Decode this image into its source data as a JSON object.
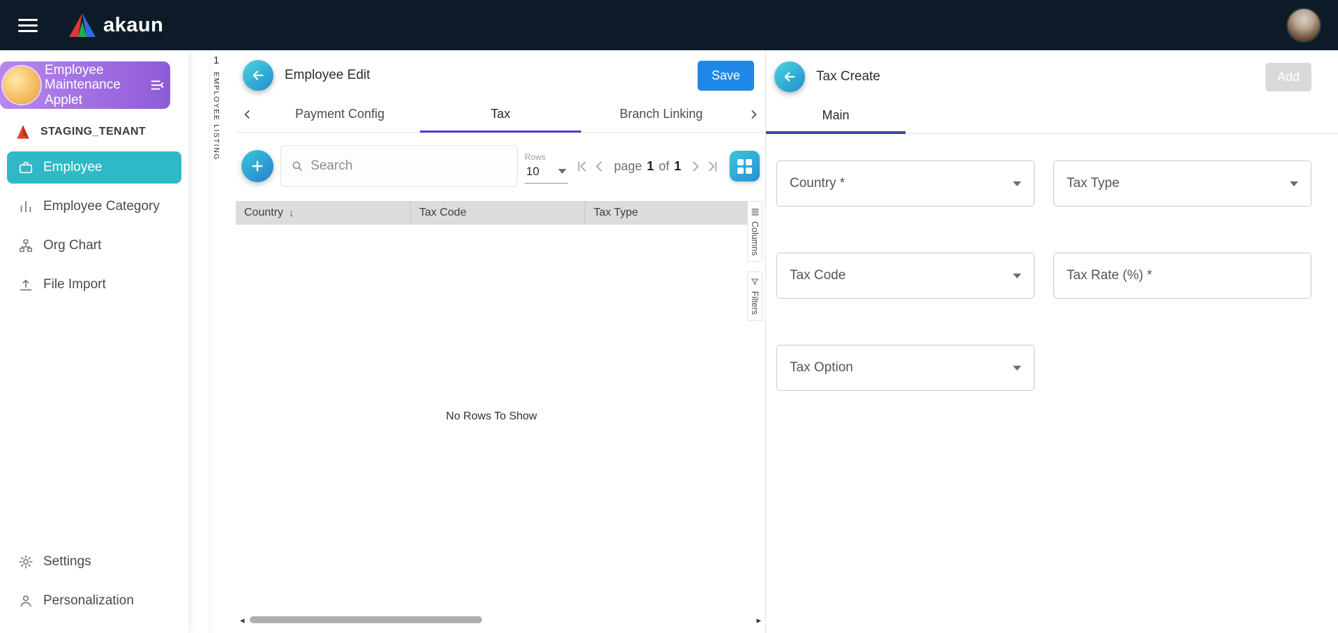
{
  "topbar": {
    "brand": "akaun"
  },
  "sidebar": {
    "applet_label": "Employee Maintenance Applet",
    "tenant_label": "STAGING_TENANT",
    "items": [
      {
        "label": "Employee",
        "active": true
      },
      {
        "label": "Employee Category",
        "active": false
      },
      {
        "label": "Org Chart",
        "active": false
      },
      {
        "label": "File Import",
        "active": false
      }
    ],
    "footer_items": [
      {
        "label": "Settings"
      },
      {
        "label": "Personalization"
      }
    ]
  },
  "listing_strip": {
    "index": "1",
    "label": "EMPLOYEE LISTING"
  },
  "employee_edit": {
    "title": "Employee Edit",
    "save_label": "Save",
    "tabs": [
      {
        "label": "Payment Config",
        "active": false
      },
      {
        "label": "Tax",
        "active": true
      },
      {
        "label": "Branch Linking",
        "active": false
      }
    ],
    "search_placeholder": "Search",
    "rows_label": "Rows",
    "rows_value": "10",
    "pagination": {
      "page_word": "page",
      "current_page": "1",
      "of_word": "of",
      "total_pages": "1"
    },
    "table": {
      "columns": [
        "Country",
        "Tax Code",
        "Tax Type"
      ],
      "sort_icon": "↓",
      "empty_message": "No Rows To Show"
    },
    "side_tabs": {
      "columns": "Columns",
      "filters": "Filters"
    }
  },
  "tax_create": {
    "title": "Tax Create",
    "add_label": "Add",
    "tab_main": "Main",
    "fields": {
      "country": "Country *",
      "tax_type": "Tax Type",
      "tax_code": "Tax Code",
      "tax_rate": "Tax Rate (%) *",
      "tax_option": "Tax Option"
    }
  },
  "colors": {
    "topbar_bg": "#0d1b28",
    "accent_teal": "#2fb9c6",
    "applet_purple": "#8e5bd8",
    "save_blue": "#1f87e8",
    "tab_active_purple": "#5b33c5",
    "tab_active_indigo": "#3b49a6",
    "tenant_red": "#e5412d",
    "disabled_button": "#d9d9d9"
  }
}
